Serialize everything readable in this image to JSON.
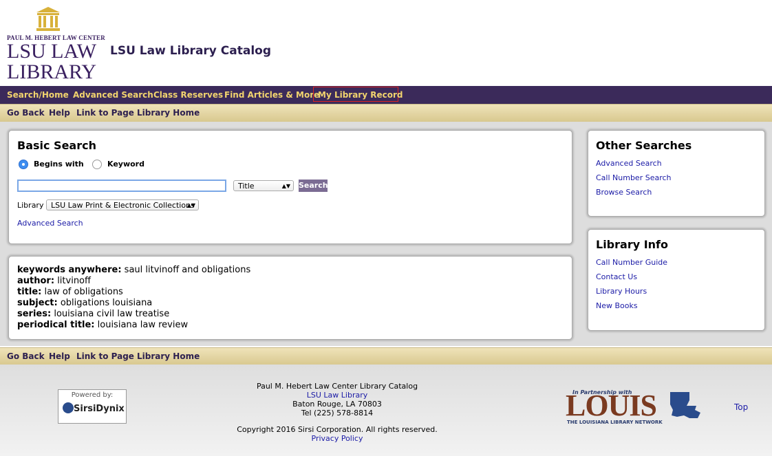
{
  "header": {
    "logo": {
      "line_small": "PAUL M. HEBERT LAW CENTER",
      "line1": "LSU LAW",
      "line2": "LIBRARY"
    },
    "catalog_title": "LSU Law Library Catalog"
  },
  "nav": {
    "items": [
      "Search/Home",
      "Advanced Search",
      "Class Reserves",
      "Find Articles & More",
      "My Library Record"
    ]
  },
  "subnav": {
    "items": [
      "Go Back",
      "Help",
      "Link to Page",
      "Library Home"
    ]
  },
  "basic_search": {
    "title": "Basic Search",
    "radio_begins": "Begins with",
    "radio_keyword": "Keyword",
    "selected_radio": "Begins with",
    "input_value": "",
    "field_select": "Title",
    "search_button": "Search",
    "library_label": "Library",
    "library_select": "LSU Law Print & Electronic Collections",
    "advanced_link": "Advanced Search"
  },
  "examples": [
    {
      "key": "keywords anywhere:",
      "value": "saul litvinoff and obligations"
    },
    {
      "key": "author:",
      "value": "litvinoff"
    },
    {
      "key": "title:",
      "value": "law of obligations"
    },
    {
      "key": "subject:",
      "value": "obligations louisiana"
    },
    {
      "key": "series:",
      "value": "louisiana civil law treatise"
    },
    {
      "key": "periodical title:",
      "value": "louisiana law review"
    }
  ],
  "other_searches": {
    "title": "Other Searches",
    "links": [
      "Advanced Search",
      "Call Number Search",
      "Browse Search"
    ]
  },
  "library_info": {
    "title": "Library Info",
    "links": [
      "Call Number Guide",
      "Contact Us",
      "Library Hours",
      "New Books"
    ]
  },
  "footer": {
    "line1": "Paul M. Hebert Law Center Library Catalog",
    "link_library": "LSU Law Library",
    "address": "Baton Rouge, LA 70803",
    "tel": "Tel (225) 578-8814",
    "copyright": "Copyright 2016 Sirsi Corporation. All rights reserved.",
    "privacy": "Privacy Policy",
    "powered_by": "Powered by:",
    "sirsi": "SirsiDynix",
    "louis_partner": "In Partnership with",
    "louis_name": "LOUIS",
    "louis_tagline": "THE LOUISIANA LIBRARY NETWORK",
    "top_link": "Top"
  },
  "colors": {
    "nav_bg": "#3b2a5a",
    "nav_text": "#f2d46e",
    "accent_button": "#7b6c93",
    "link": "#1a1aa6"
  }
}
